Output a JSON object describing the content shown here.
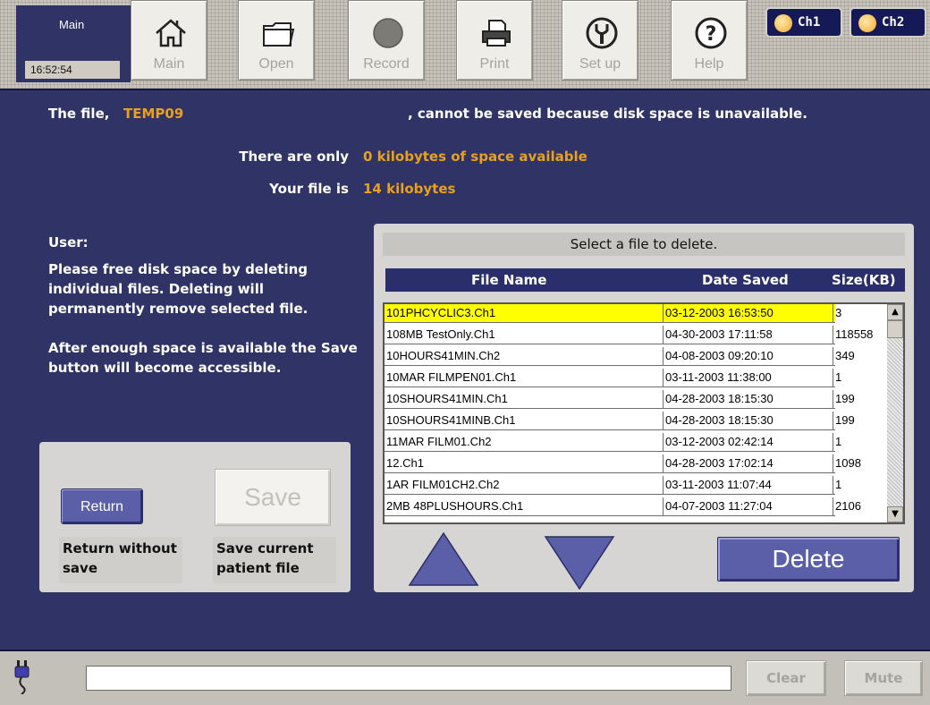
{
  "toolbar": {
    "title": "Main",
    "time": "16:52:54",
    "buttons": [
      {
        "label": "Main",
        "icon": "home-icon"
      },
      {
        "label": "Open",
        "icon": "folder-icon"
      },
      {
        "label": "Record",
        "icon": "record-icon"
      },
      {
        "label": "Print",
        "icon": "printer-icon"
      },
      {
        "label": "Set up",
        "icon": "wrench-icon"
      },
      {
        "label": "Help",
        "icon": "help-icon"
      }
    ],
    "channels": [
      "Ch1",
      "Ch2"
    ]
  },
  "message": {
    "prefix": "The file,",
    "filename": "TEMP09",
    "suffix": ", cannot be saved because disk space is unavailable.",
    "space_label": "There are only",
    "space_value": "0 kilobytes of space available",
    "size_label": "Your file is",
    "size_value": "14 kilobytes"
  },
  "user": {
    "label": "User:",
    "para1": "Please free disk space by deleting individual files. Deleting will permanently remove selected file.",
    "para2": "After enough space is available the Save button will become accessible."
  },
  "actions": {
    "return_label": "Return",
    "return_caption": "Return without save",
    "save_label": "Save",
    "save_caption": "Save current patient file"
  },
  "file_table": {
    "title": "Select a file to delete.",
    "headers": [
      "File Name",
      "Date Saved",
      "Size(KB)"
    ],
    "rows": [
      {
        "name": "101PHCYCLIC3.Ch1",
        "date": "03-12-2003 16:53:50",
        "size": "3",
        "selected": true
      },
      {
        "name": "108MB TestOnly.Ch1",
        "date": "04-30-2003 17:11:58",
        "size": "118558"
      },
      {
        "name": "10HOURS41MIN.Ch2",
        "date": "04-08-2003 09:20:10",
        "size": "349"
      },
      {
        "name": "10MAR FILMPEN01.Ch1",
        "date": "03-11-2003 11:38:00",
        "size": "1"
      },
      {
        "name": "10SHOURS41MIN.Ch1",
        "date": "04-28-2003 18:15:30",
        "size": "199"
      },
      {
        "name": "10SHOURS41MINB.Ch1",
        "date": "04-28-2003 18:15:30",
        "size": "199"
      },
      {
        "name": "11MAR FILM01.Ch2",
        "date": "03-12-2003 02:42:14",
        "size": "1"
      },
      {
        "name": "12.Ch1",
        "date": "04-28-2003 17:02:14",
        "size": "1098"
      },
      {
        "name": "1AR FILM01CH2.Ch2",
        "date": "03-11-2003 11:07:44",
        "size": "1"
      },
      {
        "name": "2MB 48PLUSHOURS.Ch1",
        "date": "04-07-2003 11:27:04",
        "size": "2106"
      }
    ],
    "delete_label": "Delete"
  },
  "statusbar": {
    "input_value": "",
    "clear_label": "Clear",
    "mute_label": "Mute",
    "icon": "plug-icon"
  },
  "colors": {
    "background": "#2f3366",
    "accent_text": "#e8a020",
    "selected_row": "#ffff00",
    "button_blue": "#5a5fa8"
  }
}
